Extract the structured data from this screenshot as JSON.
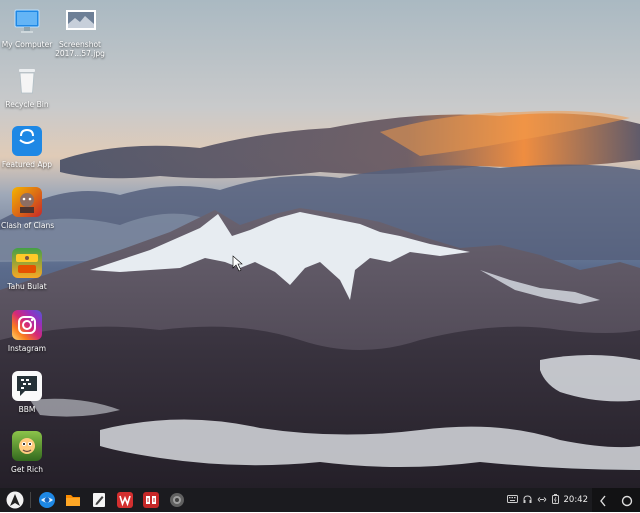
{
  "desktop": {
    "icons": [
      {
        "label": "My Computer",
        "icon": "monitor-icon"
      },
      {
        "label": "Screenshot\n2017...57.jpg",
        "icon": "image-file-icon"
      },
      {
        "label": "Recycle Bin",
        "icon": "trash-icon"
      },
      {
        "label": "Featured App",
        "icon": "shopping-bag-icon"
      },
      {
        "label": "Clash of Clans",
        "icon": "game-icon"
      },
      {
        "label": "Tahu Bulat",
        "icon": "game-icon"
      },
      {
        "label": "Instagram",
        "icon": "camera-icon"
      },
      {
        "label": "BBM",
        "icon": "chat-icon"
      },
      {
        "label": "Get Rich",
        "icon": "game-icon"
      }
    ]
  },
  "taskbar": {
    "apps": [
      "start-icon",
      "browser-icon",
      "file-manager-icon",
      "notes-icon",
      "office-icon",
      "app-store-icon",
      "settings-icon"
    ],
    "tray": {
      "clock": "20:42"
    }
  },
  "colors": {
    "taskbar_bg": "#1b1b1f",
    "accent_blue": "#1e88e5",
    "instagram": "#c13584",
    "wps_red": "#d32f2f"
  }
}
